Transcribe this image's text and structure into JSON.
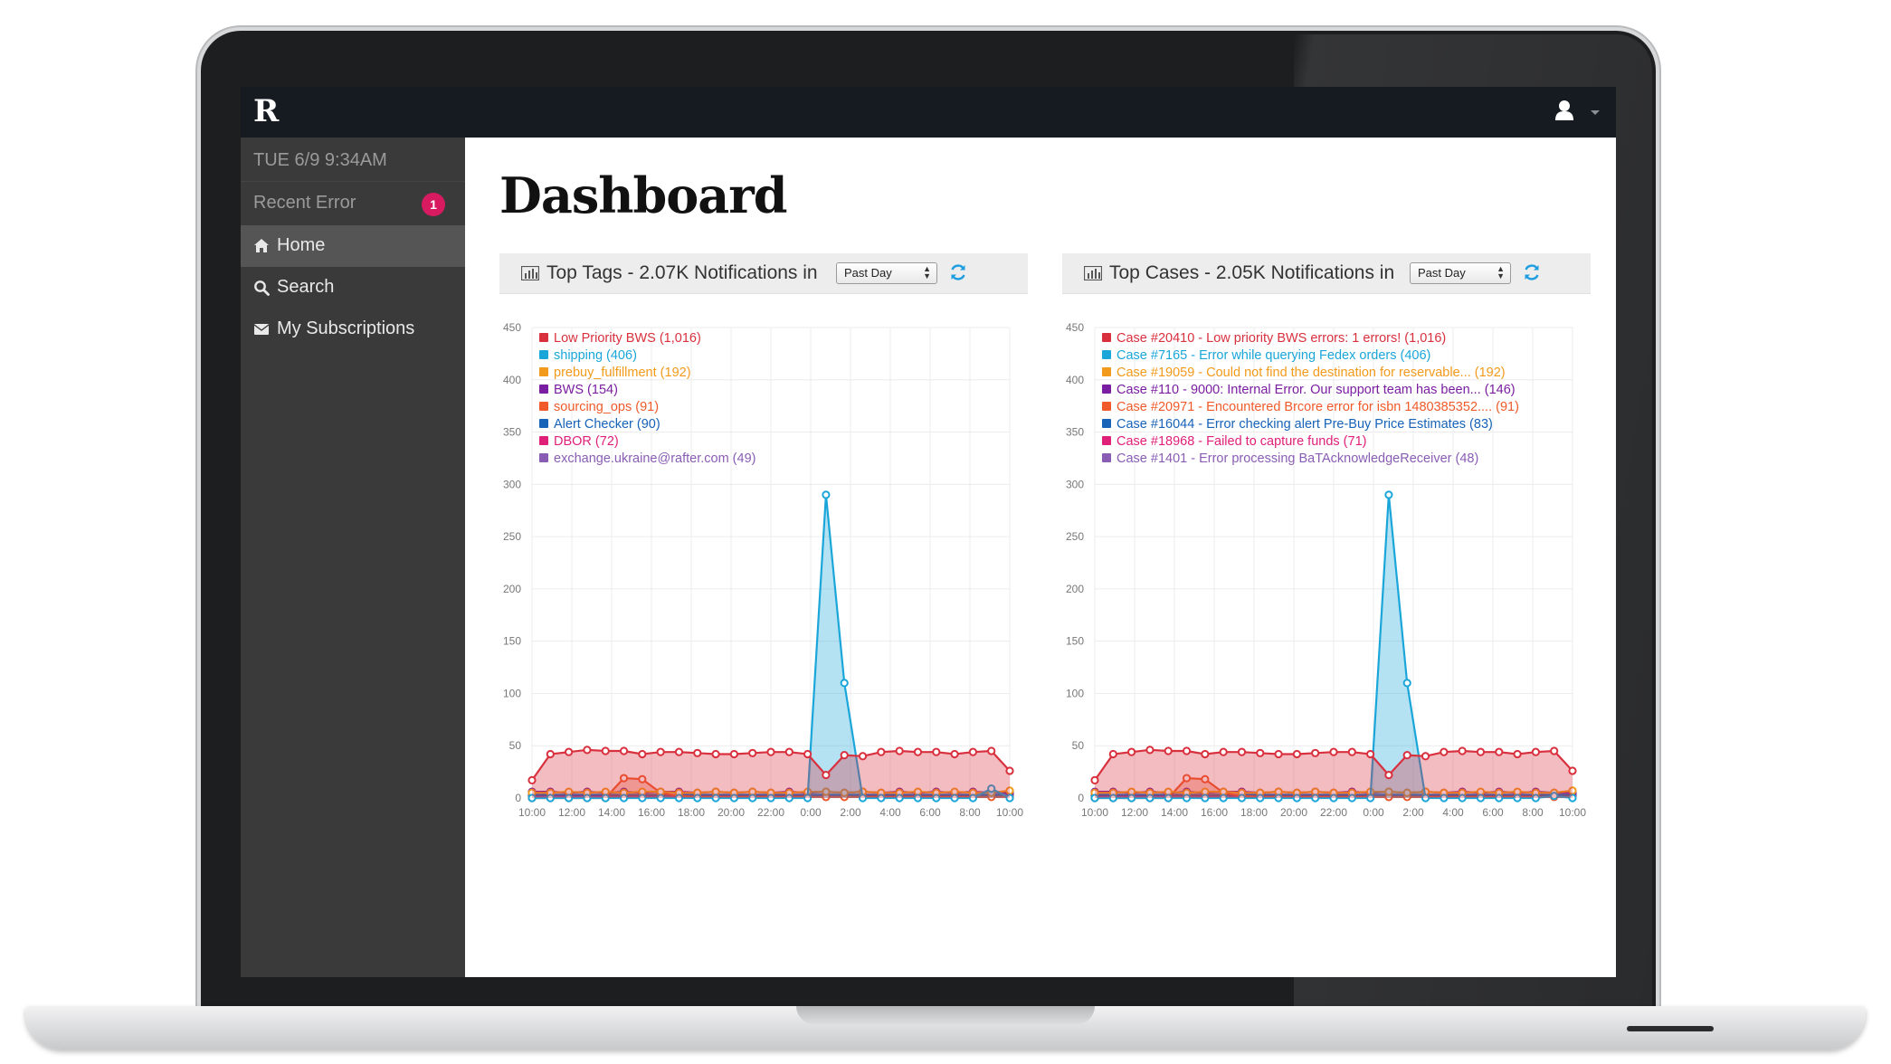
{
  "navbar": {
    "logo_text": "R",
    "user_icon": "user-icon",
    "menu_caret": "chevron-down-icon"
  },
  "sidebar": {
    "datetime": "TUE 6/9 9:34AM",
    "recent_error": {
      "label": "Recent Error",
      "count": "1"
    },
    "items": [
      {
        "label": "Home",
        "icon": "home-icon",
        "active": true
      },
      {
        "label": "Search",
        "icon": "search-icon",
        "active": false
      },
      {
        "label": "My Subscriptions",
        "icon": "envelope-icon",
        "active": false
      }
    ]
  },
  "main": {
    "title": "Dashboard",
    "panels": [
      {
        "title": "Top Tags - 2.07K Notifications in",
        "period": "Past Day",
        "icon": "bar-chart-icon",
        "refresh_icon": "refresh-icon"
      },
      {
        "title": "Top Cases - 2.05K Notifications in",
        "period": "Past Day",
        "icon": "bar-chart-icon",
        "refresh_icon": "refresh-icon"
      }
    ]
  },
  "colors": {
    "low_priority": "#d9303e",
    "shipping": "#1aa6d9",
    "prebuy": "#f29a1b",
    "bws": "#7a1ea1",
    "sourcing": "#f05a2a",
    "alert_checker": "#1663b8",
    "dbor": "#e01f79",
    "exchange": "#8a5db5",
    "sidebar_bg": "#3a3a3a",
    "navbar_bg": "#161b21",
    "badge": "#d81b60"
  },
  "chart_data": [
    {
      "type": "area",
      "ylim": [
        0,
        450
      ],
      "yticks": [
        "0",
        "50",
        "100",
        "150",
        "200",
        "250",
        "300",
        "350",
        "400",
        "450"
      ],
      "xticks": [
        "10:00",
        "12:00",
        "14:00",
        "16:00",
        "18:00",
        "20:00",
        "22:00",
        "0:00",
        "2:00",
        "4:00",
        "6:00",
        "8:00",
        "10:00"
      ],
      "legend_position": "top-left",
      "series": [
        {
          "name": "Low Priority BWS (1,016)",
          "color": "#d9303e",
          "fill": true,
          "values": [
            17,
            42,
            44,
            46,
            45,
            45,
            42,
            44,
            44,
            43,
            42,
            42,
            43,
            44,
            44,
            42,
            22,
            41,
            40,
            44,
            45,
            44,
            44,
            42,
            44,
            45,
            26
          ]
        },
        {
          "name": "shipping (406)",
          "color": "#1aa6d9",
          "fill": true,
          "values": [
            0,
            0,
            0,
            0,
            0,
            0,
            0,
            0,
            0,
            0,
            0,
            0,
            0,
            0,
            0,
            0,
            290,
            110,
            0,
            0,
            0,
            0,
            0,
            0,
            0,
            9,
            0
          ]
        },
        {
          "name": "prebuy_fulfillment (192)",
          "color": "#f29a1b",
          "fill": false,
          "values": [
            5,
            5,
            6,
            5,
            6,
            5,
            6,
            6,
            5,
            5,
            6,
            5,
            6,
            5,
            5,
            6,
            6,
            5,
            6,
            5,
            5,
            6,
            5,
            6,
            5,
            5,
            7
          ]
        },
        {
          "name": "BWS (154)",
          "color": "#7a1ea1",
          "fill": false,
          "values": [
            6,
            6,
            5,
            6,
            5,
            6,
            5,
            6,
            6,
            5,
            6,
            5,
            6,
            5,
            6,
            5,
            6,
            5,
            6,
            5,
            6,
            5,
            6,
            5,
            6,
            5,
            5
          ]
        },
        {
          "name": "sourcing_ops (91)",
          "color": "#f05a2a",
          "fill": true,
          "values": [
            0,
            0,
            0,
            0,
            0,
            19,
            18,
            5,
            2,
            1,
            1,
            1,
            1,
            1,
            1,
            1,
            1,
            1,
            1,
            1,
            1,
            1,
            1,
            1,
            1,
            1,
            1
          ]
        },
        {
          "name": "Alert Checker (90)",
          "color": "#1663b8",
          "fill": false,
          "values": [
            3,
            3,
            3,
            3,
            3,
            3,
            3,
            3,
            3,
            3,
            3,
            3,
            3,
            3,
            3,
            3,
            3,
            3,
            3,
            3,
            3,
            3,
            3,
            3,
            3,
            3,
            3
          ]
        },
        {
          "name": "DBOR (72)",
          "color": "#e01f79",
          "fill": false,
          "values": [
            2,
            3,
            2,
            3,
            2,
            3,
            2,
            3,
            2,
            3,
            2,
            3,
            2,
            3,
            2,
            3,
            2,
            3,
            2,
            3,
            2,
            3,
            2,
            3,
            2,
            3,
            2
          ]
        },
        {
          "name": "exchange.ukraine@rafter.com (49)",
          "color": "#8a5db5",
          "fill": false,
          "values": [
            1,
            2,
            1,
            2,
            1,
            2,
            1,
            2,
            1,
            2,
            1,
            2,
            1,
            2,
            1,
            2,
            1,
            2,
            1,
            2,
            1,
            2,
            1,
            2,
            1,
            2,
            1
          ]
        }
      ]
    },
    {
      "type": "area",
      "ylim": [
        0,
        450
      ],
      "yticks": [
        "0",
        "50",
        "100",
        "150",
        "200",
        "250",
        "300",
        "350",
        "400",
        "450"
      ],
      "xticks": [
        "10:00",
        "12:00",
        "14:00",
        "16:00",
        "18:00",
        "20:00",
        "22:00",
        "0:00",
        "2:00",
        "4:00",
        "6:00",
        "8:00",
        "10:00"
      ],
      "legend_position": "top-left",
      "series": [
        {
          "name": "Case #20410 - Low priority BWS errors: 1 errors! (1,016)",
          "color": "#d9303e",
          "fill": true,
          "values": [
            17,
            42,
            44,
            46,
            45,
            45,
            42,
            44,
            44,
            43,
            42,
            42,
            43,
            44,
            44,
            42,
            22,
            41,
            40,
            44,
            45,
            44,
            44,
            42,
            44,
            45,
            26
          ]
        },
        {
          "name": "Case #7165 - Error while querying Fedex orders (406)",
          "color": "#1aa6d9",
          "fill": true,
          "values": [
            0,
            0,
            0,
            0,
            0,
            0,
            0,
            0,
            0,
            0,
            0,
            0,
            0,
            0,
            0,
            0,
            290,
            110,
            0,
            0,
            0,
            0,
            0,
            0,
            0,
            2,
            0
          ]
        },
        {
          "name": "Case #19059 - Could not find the destination for reservable... (192)",
          "color": "#f29a1b",
          "fill": false,
          "values": [
            5,
            5,
            6,
            5,
            6,
            5,
            6,
            6,
            5,
            5,
            6,
            5,
            6,
            5,
            5,
            6,
            6,
            5,
            6,
            5,
            5,
            6,
            5,
            6,
            5,
            5,
            7
          ]
        },
        {
          "name": "Case #110 - 9000: Internal Error. Our support team has been... (146)",
          "color": "#7a1ea1",
          "fill": false,
          "values": [
            6,
            6,
            5,
            6,
            5,
            6,
            5,
            6,
            6,
            5,
            6,
            5,
            6,
            5,
            6,
            5,
            6,
            5,
            6,
            5,
            6,
            5,
            6,
            5,
            6,
            5,
            5
          ]
        },
        {
          "name": "Case #20971 - Encountered Brcore error for isbn 1480385352.... (91)",
          "color": "#f05a2a",
          "fill": true,
          "values": [
            0,
            0,
            0,
            0,
            0,
            19,
            18,
            5,
            2,
            1,
            1,
            1,
            1,
            1,
            1,
            1,
            1,
            1,
            1,
            1,
            1,
            1,
            1,
            1,
            1,
            1,
            1
          ]
        },
        {
          "name": "Case #16044 - Error checking alert Pre-Buy Price Estimates (83)",
          "color": "#1663b8",
          "fill": false,
          "values": [
            3,
            3,
            3,
            3,
            3,
            3,
            3,
            3,
            3,
            3,
            3,
            3,
            3,
            3,
            3,
            3,
            3,
            3,
            3,
            3,
            3,
            3,
            3,
            3,
            3,
            3,
            3
          ]
        },
        {
          "name": "Case #18968 - Failed to capture funds (71)",
          "color": "#e01f79",
          "fill": false,
          "values": [
            2,
            3,
            2,
            3,
            2,
            3,
            2,
            3,
            2,
            3,
            2,
            3,
            2,
            3,
            2,
            3,
            2,
            3,
            2,
            3,
            2,
            3,
            2,
            3,
            2,
            3,
            2
          ]
        },
        {
          "name": "Case #1401 - Error processing BaTAcknowledgeReceiver (48)",
          "color": "#8a5db5",
          "fill": false,
          "values": [
            1,
            2,
            1,
            2,
            1,
            2,
            1,
            2,
            1,
            2,
            1,
            2,
            1,
            2,
            1,
            2,
            1,
            2,
            1,
            2,
            1,
            2,
            1,
            2,
            1,
            2,
            1
          ]
        }
      ]
    }
  ]
}
